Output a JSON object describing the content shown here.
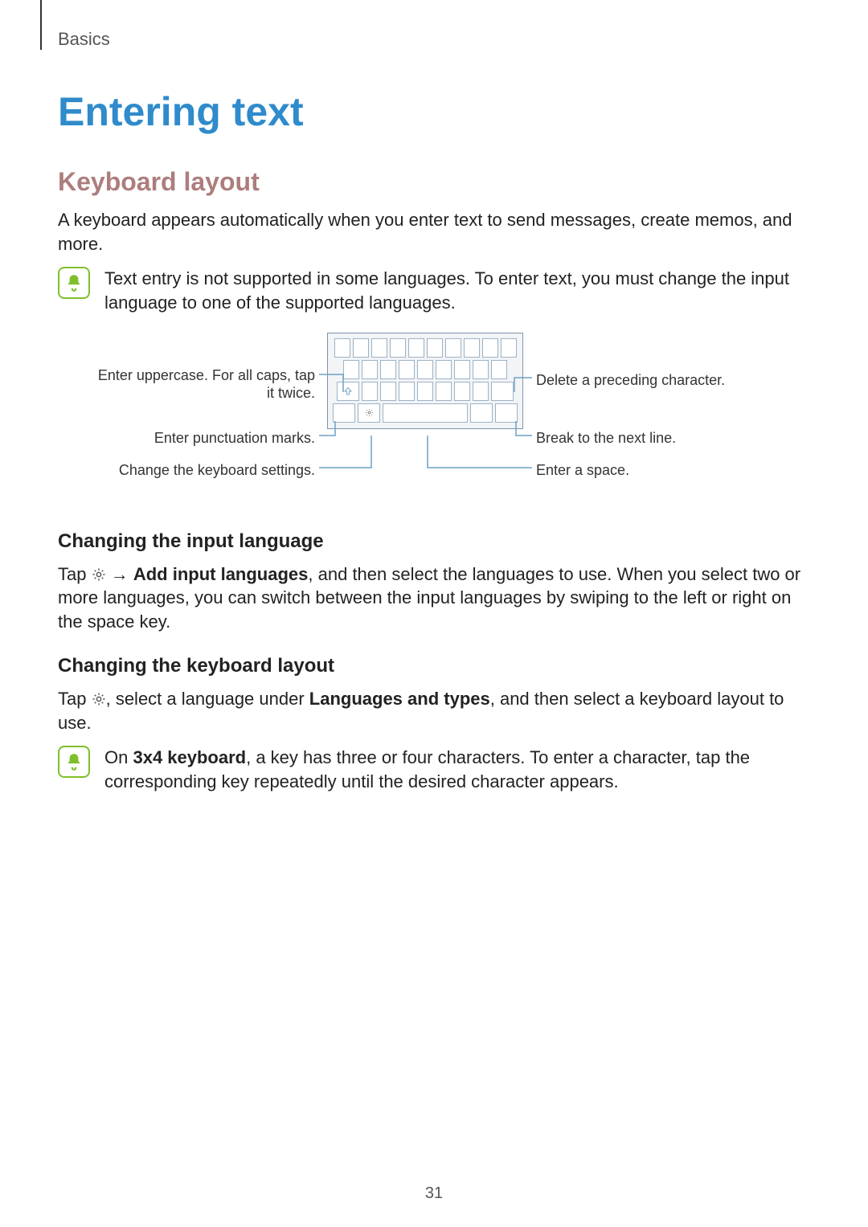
{
  "breadcrumb": "Basics",
  "title": "Entering text",
  "section_keyboard": "Keyboard layout",
  "para_intro": "A keyboard appears automatically when you enter text to send messages, create memos, and more.",
  "note1": "Text entry is not supported in some languages. To enter text, you must change the input language to one of the supported languages.",
  "callouts": {
    "uppercase": "Enter uppercase. For all caps, tap\nit twice.",
    "punctuation": "Enter punctuation marks.",
    "settings": "Change the keyboard settings.",
    "delete": "Delete a preceding character.",
    "nextline": "Break to the next line.",
    "space": "Enter a space."
  },
  "sub_input_lang": "Changing the input language",
  "para_input_lang_pre": "Tap ",
  "para_input_lang_arrow": " → ",
  "para_input_lang_bold": "Add input languages",
  "para_input_lang_post": ", and then select the languages to use. When you select two or more languages, you can switch between the input languages by swiping to the left or right on the space key.",
  "sub_layout": "Changing the keyboard layout",
  "para_layout_pre": "Tap ",
  "para_layout_mid": ", select a language under ",
  "para_layout_bold": "Languages and types",
  "para_layout_post": ", and then select a keyboard layout to use.",
  "note2_pre": "On ",
  "note2_bold": "3x4 keyboard",
  "note2_post": ", a key has three or four characters. To enter a character, tap the corresponding key repeatedly until the desired character appears.",
  "page_number": "31"
}
